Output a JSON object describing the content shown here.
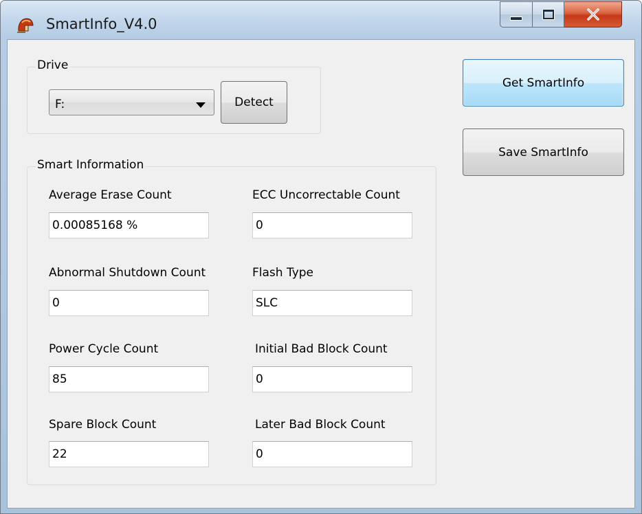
{
  "window": {
    "title": "SmartInfo_V4.0",
    "icon": "spartan-helmet-icon",
    "close_color": "#c5391a"
  },
  "drive": {
    "group_label": "Drive",
    "selected_drive": "F:",
    "detect_label": "Detect"
  },
  "actions": {
    "get_label": "Get SmartInfo",
    "save_label": "Save SmartInfo"
  },
  "smart": {
    "group_label": "Smart Information",
    "fields": [
      {
        "label": "Average Erase Count",
        "value": "0.00085168 %"
      },
      {
        "label": "ECC Uncorrectable Count",
        "value": "0"
      },
      {
        "label": "Abnormal Shutdown Count",
        "value": "0"
      },
      {
        "label": "Flash Type",
        "value": "SLC"
      },
      {
        "label": "Power Cycle Count",
        "value": "85"
      },
      {
        "label": "Initial Bad Block Count",
        "value": "0"
      },
      {
        "label": "Spare Block Count",
        "value": "22"
      },
      {
        "label": "Later Bad Block Count",
        "value": "0"
      }
    ]
  }
}
